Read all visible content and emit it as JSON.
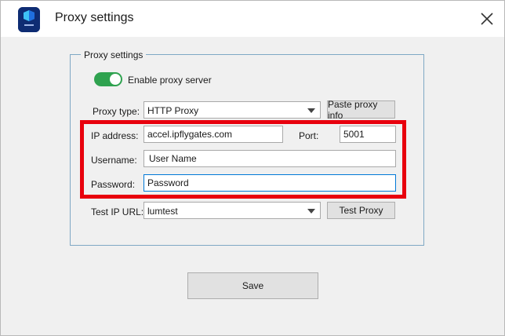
{
  "window": {
    "title": "Proxy settings"
  },
  "group": {
    "legend": "Proxy settings"
  },
  "enable_proxy": {
    "label": "Enable proxy server",
    "on": true
  },
  "proxy_type": {
    "label": "Proxy type:",
    "value": "HTTP Proxy",
    "paste_label": "Paste proxy info"
  },
  "ip_address": {
    "label": "IP address:",
    "value": "accel.ipflygates.com"
  },
  "port": {
    "label": "Port:",
    "value": "5001"
  },
  "username": {
    "label": "Username:",
    "value": "User Name"
  },
  "password": {
    "label": "Password:",
    "value": "Password"
  },
  "test_ip_url": {
    "label": "Test IP URL:",
    "value": "lumtest",
    "test_label": "Test Proxy"
  },
  "save": {
    "label": "Save"
  },
  "colors": {
    "toggle_on": "#2fa24f",
    "highlight": "#e8000d",
    "focus_border": "#0078d7",
    "group_border": "#7fa8c4"
  }
}
